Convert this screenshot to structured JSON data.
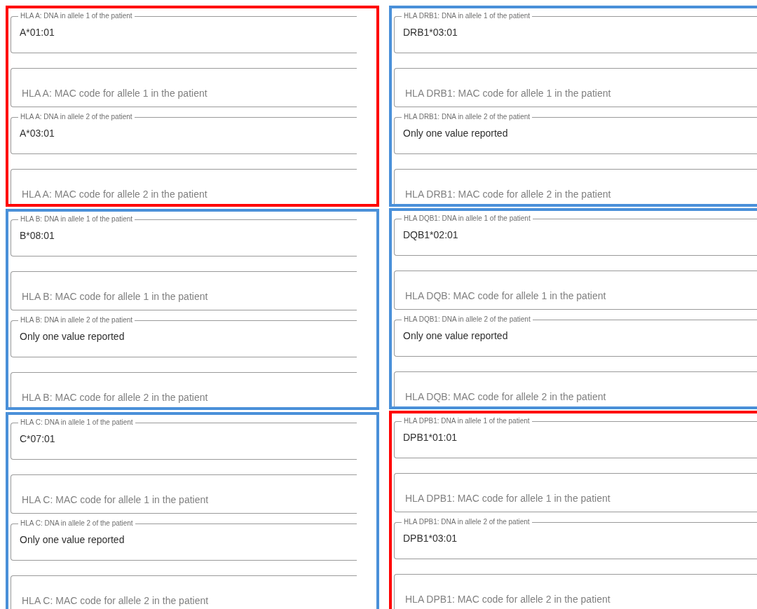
{
  "columns": [
    {
      "groups": [
        {
          "color": "#ff0000",
          "fields": [
            {
              "label": "HLA A: DNA in allele 1 of the patient",
              "value": "A*01:01"
            },
            {
              "placeholder": "HLA A: MAC code for allele 1 in the patient"
            },
            {
              "label": "HLA A: DNA in allele 2 of the patient",
              "value": "A*03:01"
            },
            {
              "placeholder": "HLA A: MAC code for allele 2 in the patient"
            }
          ]
        },
        {
          "color": "#4a90d9",
          "fields": [
            {
              "label": "HLA B: DNA in allele 1 of the patient",
              "value": "B*08:01"
            },
            {
              "placeholder": "HLA B: MAC code for allele 1 in the patient"
            },
            {
              "label": "HLA B: DNA in allele 2 of the patient",
              "value": "Only one value reported"
            },
            {
              "placeholder": "HLA B: MAC code for allele 2 in the patient"
            }
          ]
        },
        {
          "color": "#4a90d9",
          "fields": [
            {
              "label": "HLA C: DNA in allele 1 of the patient",
              "value": "C*07:01"
            },
            {
              "placeholder": "HLA C: MAC code for allele 1 in the patient"
            },
            {
              "label": "HLA C: DNA in allele 2 of the patient",
              "value": "Only one value reported"
            },
            {
              "placeholder": "HLA C: MAC code for allele 2 in the patient"
            }
          ]
        }
      ]
    },
    {
      "groups": [
        {
          "color": "#4a90d9",
          "fields": [
            {
              "label": "HLA DRB1: DNA in allele 1 of the patient",
              "value": "DRB1*03:01"
            },
            {
              "placeholder": "HLA DRB1: MAC code for allele 1 in the patient"
            },
            {
              "label": "HLA DRB1: DNA in allele 2 of the patient",
              "value": "Only one value reported"
            },
            {
              "placeholder": "HLA DRB1: MAC code for allele 2 in the patient"
            }
          ]
        },
        {
          "color": "#4a90d9",
          "fields": [
            {
              "label": "HLA DQB1: DNA in allele 1 of the patient",
              "value": "DQB1*02:01"
            },
            {
              "placeholder": "HLA DQB: MAC code for allele 1 in the patient"
            },
            {
              "label": "HLA DQB1: DNA in allele 2 of the patient",
              "value": "Only one value reported"
            },
            {
              "placeholder": "HLA DQB: MAC code for allele 2 in the patient"
            }
          ]
        },
        {
          "color": "#ff0000",
          "fields": [
            {
              "label": "HLA DPB1: DNA in allele 1 of the patient",
              "value": "DPB1*01:01"
            },
            {
              "placeholder": "HLA DPB1: MAC code for allele 1 in the patient"
            },
            {
              "label": "HLA DPB1: DNA in allele 2 of the patient",
              "value": "DPB1*03:01"
            },
            {
              "placeholder": "HLA DPB1: MAC code for allele 2 in the patient"
            }
          ]
        }
      ]
    }
  ]
}
